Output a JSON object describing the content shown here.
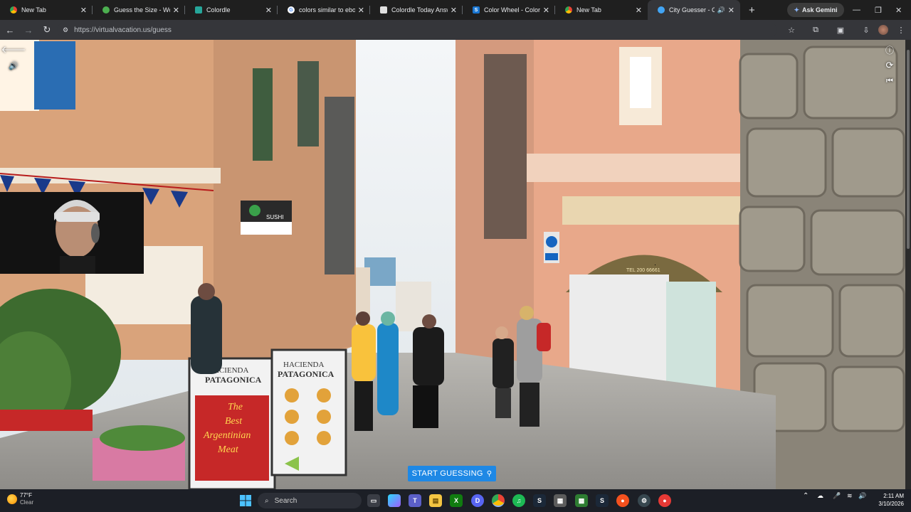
{
  "browser": {
    "tabs": [
      {
        "label": "New Tab",
        "icon": "chrome-icon",
        "active": false
      },
      {
        "label": "Guess the Size - Worldl",
        "icon": "globe-icon",
        "active": false
      },
      {
        "label": "Colordle",
        "icon": "colordle-icon",
        "active": false
      },
      {
        "label": "colors similar to ebony",
        "icon": "google-icon",
        "active": false
      },
      {
        "label": "Colordle Today Answe",
        "icon": "page-icon",
        "active": false
      },
      {
        "label": "Color Wheel - Color Ca",
        "icon": "s-icon",
        "active": false
      },
      {
        "label": "New Tab",
        "icon": "chrome-icon",
        "active": false
      },
      {
        "label": "City Guesser - Can",
        "icon": "globe-icon",
        "active": true
      }
    ],
    "ask_gemini": "Ask Gemini",
    "url": "https://virtualvacation.us/guess"
  },
  "page": {
    "cta_label": "START GUESSING",
    "cta_icon": "map-pin-icon",
    "scene": {
      "sushi_sign": "SUSHI",
      "menu_board_1": [
        "HACIENDA",
        "PATAGONICA",
        "The",
        "Best",
        "Argentinian",
        "Meat"
      ],
      "menu_board_2": [
        "HACIENDA",
        "PATAGONICA"
      ],
      "shop_phone": "TEL 200 66661"
    }
  },
  "taskbar": {
    "weather_temp": "77°F",
    "weather_desc": "Clear",
    "search_label": "Search",
    "time": "2:11 AM",
    "date": "3/10/2026"
  },
  "colors": {
    "accent": "#1e88e5",
    "chrome_bg": "#1f1f1f",
    "toolbar_bg": "#35363a",
    "taskbar_bg": "#1c1f26"
  }
}
